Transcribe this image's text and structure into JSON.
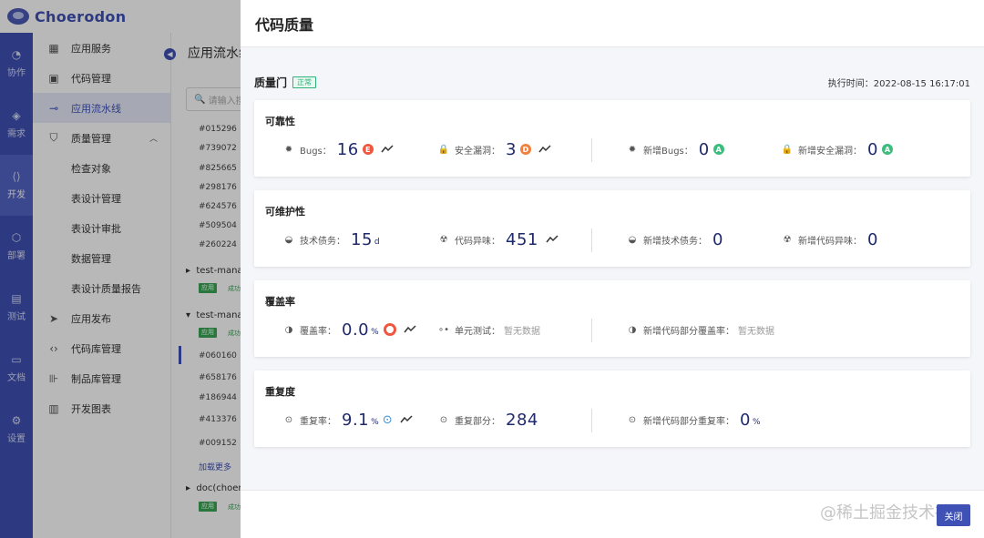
{
  "app": {
    "name": "Choerodon"
  },
  "rail": [
    {
      "label": "协作",
      "icon": "collab-icon"
    },
    {
      "label": "需求",
      "icon": "demand-icon"
    },
    {
      "label": "开发",
      "icon": "dev-icon",
      "active": true
    },
    {
      "label": "部署",
      "icon": "deploy-icon"
    },
    {
      "label": "测试",
      "icon": "test-icon"
    },
    {
      "label": "文档",
      "icon": "doc-icon"
    },
    {
      "label": "设置",
      "icon": "settings-icon"
    }
  ],
  "subnav": {
    "items": [
      {
        "label": "应用服务"
      },
      {
        "label": "代码管理"
      },
      {
        "label": "应用流水线",
        "active": true
      },
      {
        "label": "质量管理",
        "expanded": true
      },
      {
        "label": "检查对象",
        "child": true
      },
      {
        "label": "表设计管理",
        "child": true
      },
      {
        "label": "表设计审批",
        "child": true
      },
      {
        "label": "数据管理",
        "child": true
      },
      {
        "label": "表设计质量报告",
        "child": true
      },
      {
        "label": "应用发布"
      },
      {
        "label": "代码库管理"
      },
      {
        "label": "制品库管理"
      },
      {
        "label": "开发图表"
      }
    ]
  },
  "middle": {
    "title": "应用流水线",
    "search_placeholder": "请输入搜索",
    "rows_a": [
      "#015296",
      "#739072",
      "#825665",
      "#298176",
      "#624576",
      "#509504",
      "#260224"
    ],
    "group1": "test-manager",
    "group1_tag": "应用",
    "group1_tag2": "成功",
    "group2": "test-manager",
    "group2_tag": "应用",
    "group2_tag2": "成功",
    "rows_b": [
      "#060160",
      "#658176",
      "#186944",
      "#413376",
      "#009152"
    ],
    "load_more": "加载更多",
    "group3": "doc(choerodon)",
    "group3_tag": "应用",
    "group3_tag2": "成功"
  },
  "drawer": {
    "title": "代码质量",
    "gate_label": "质量门",
    "gate_status": "正常",
    "exec_time": "执行时间：2022-08-15 16:17:01",
    "reliability": {
      "title": "可靠性",
      "bugs_label": "Bugs：",
      "bugs_value": "16",
      "bugs_grade": "E",
      "vuln_label": "安全漏洞：",
      "vuln_value": "3",
      "vuln_grade": "D",
      "new_bugs_label": "新增Bugs：",
      "new_bugs_value": "0",
      "new_bugs_grade": "A",
      "new_vuln_label": "新增安全漏洞：",
      "new_vuln_value": "0",
      "new_vuln_grade": "A"
    },
    "maintainability": {
      "title": "可维护性",
      "debt_label": "技术债务：",
      "debt_value": "15",
      "debt_unit": "d",
      "smell_label": "代码异味：",
      "smell_value": "451",
      "new_debt_label": "新增技术债务：",
      "new_debt_value": "0",
      "new_smell_label": "新增代码异味：",
      "new_smell_value": "0"
    },
    "coverage": {
      "title": "覆盖率",
      "cov_label": "覆盖率：",
      "cov_value": "0.0",
      "cov_unit": "%",
      "unit_label": "单元测试：",
      "unit_value": "暂无数据",
      "new_cov_label": "新增代码部分覆盖率：",
      "new_cov_value": "暂无数据"
    },
    "duplication": {
      "title": "重复度",
      "dup_label": "重复率：",
      "dup_value": "9.1",
      "dup_unit": "%",
      "dup_part_label": "重复部分：",
      "dup_part_value": "284",
      "new_dup_label": "新增代码部分重复率：",
      "new_dup_value": "0",
      "new_dup_unit": "%"
    },
    "close_label": "关闭",
    "watermark": "@稀土掘金技术社区"
  },
  "colors": {
    "primary": "#3f51b5",
    "grade_e": "#f0573f",
    "grade_d": "#f0803c",
    "grade_a": "#3dbd7d"
  }
}
